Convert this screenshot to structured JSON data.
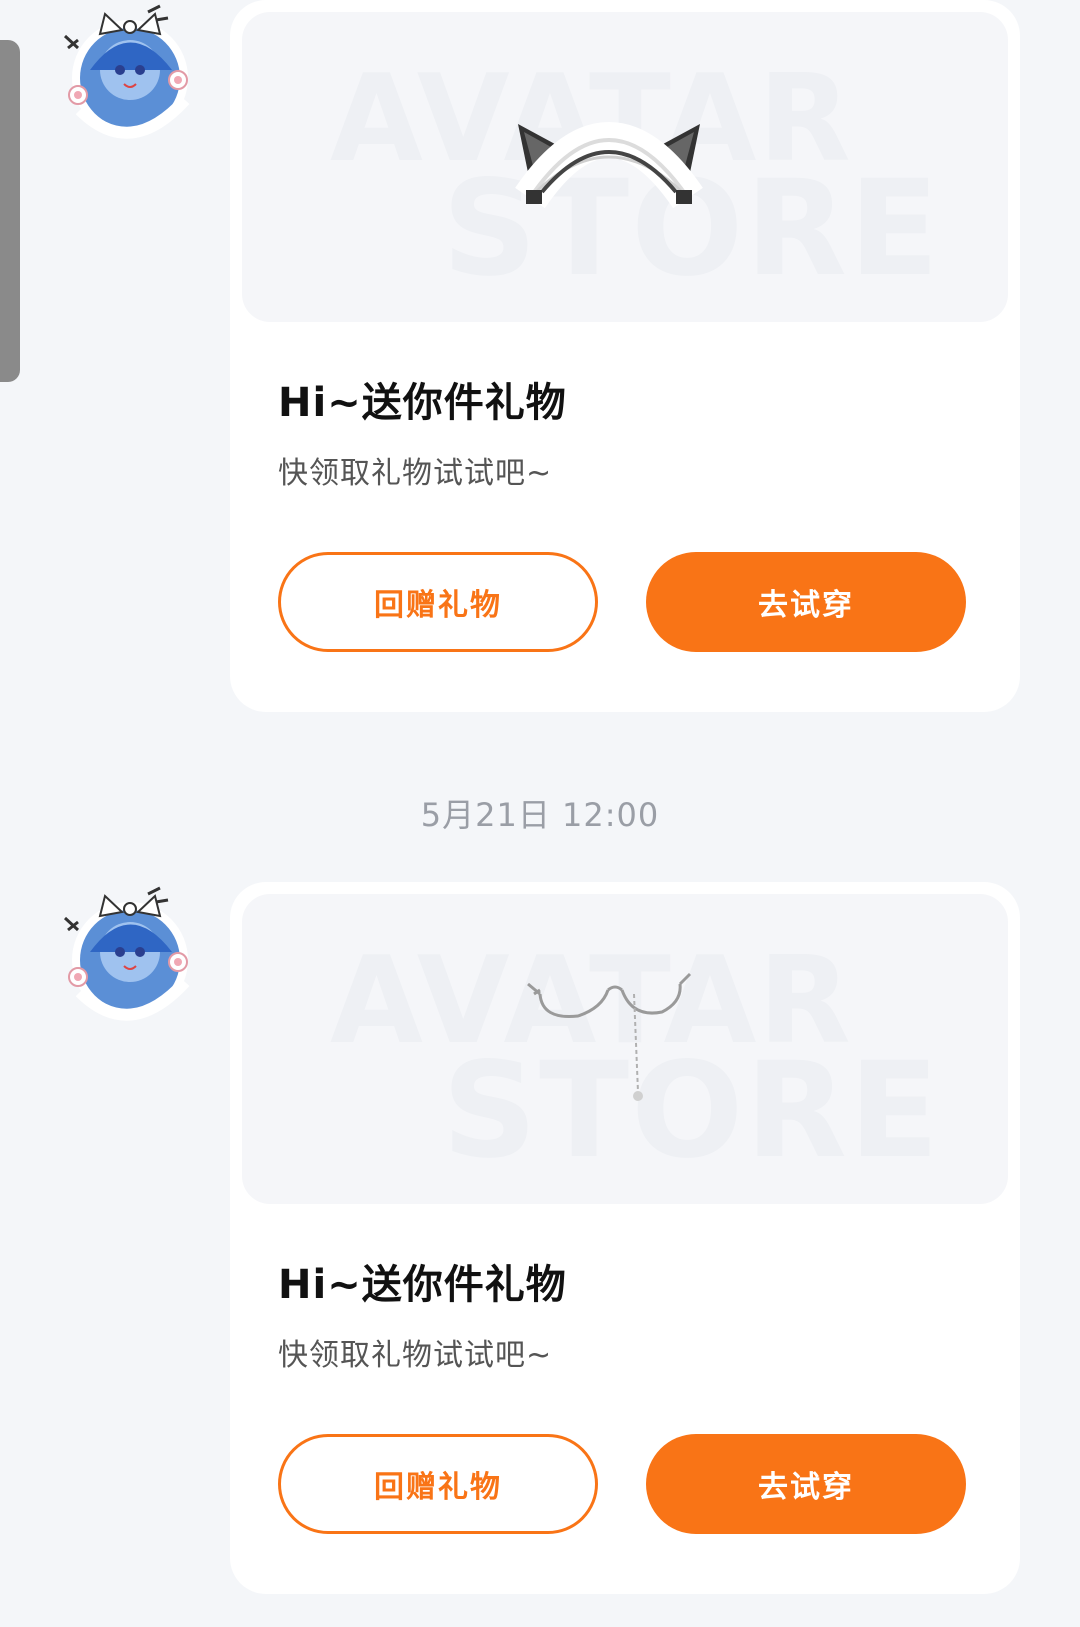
{
  "messages": [
    {
      "avatar_icon": "anime-cat-girl-avatar-icon",
      "preview": {
        "watermark_line1": "AVATAR",
        "watermark_line2": "STORE",
        "item_icon": "cat-ear-maid-headband-icon"
      },
      "title": "Hi~送你件礼物",
      "subtitle": "快领取礼物试试吧~",
      "return_gift_label": "回赠礼物",
      "try_on_label": "去试穿"
    },
    {
      "avatar_icon": "anime-cat-girl-avatar-icon",
      "preview": {
        "watermark_line1": "AVATAR",
        "watermark_line2": "STORE",
        "item_icon": "glasses-with-chain-icon"
      },
      "title": "Hi~送你件礼物",
      "subtitle": "快领取礼物试试吧~",
      "return_gift_label": "回赠礼物",
      "try_on_label": "去试穿"
    }
  ],
  "timestamp": "5月21日  12:00",
  "colors": {
    "accent": "#f97416",
    "background": "#f4f6f9",
    "card": "#ffffff"
  }
}
